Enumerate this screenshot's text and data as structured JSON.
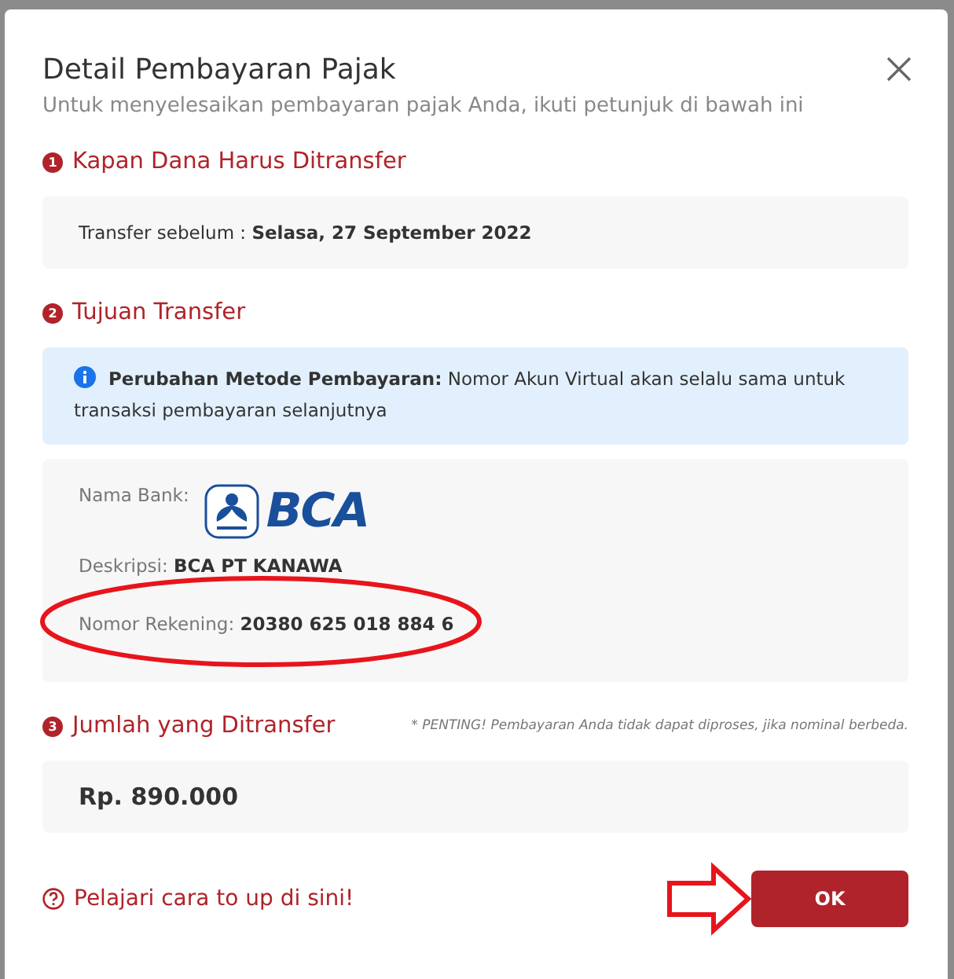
{
  "dialog": {
    "title": "Detail Pembayaran Pajak",
    "subtitle": "Untuk menyelesaikan pembayaran pajak Anda, ikuti petunjuk di bawah ini"
  },
  "sections": [
    {
      "number": "1",
      "heading": "Kapan Dana Harus Ditransfer",
      "kind": "deadline",
      "label": "Transfer sebelum :",
      "value": "Selasa, 27 September 2022"
    },
    {
      "number": "2",
      "heading": "Tujuan Transfer",
      "kind": "destination",
      "notice": "**Perubahan Metode Pembayaran:** Nomor Akun Virtual akan selalu sama untuk transaksi pembayaran selanjutnya",
      "bank_label": "Nama Bank:",
      "bank_logo_text": "BCA",
      "description_label": "Deskripsi:",
      "description_value": "BCA PT KANAWA",
      "account_label": "Nomor Rekening:",
      "account_value": "20380 625 018 884 6"
    },
    {
      "number": "3",
      "heading": "Jumlah yang Ditransfer",
      "kind": "amount",
      "note": "* PENTING! Pembayaran Anda tidak dapat diproses, jika nominal berbeda.",
      "value": "Rp. 890.000"
    }
  ],
  "help_link": "Pelajari cara to up di sini!",
  "ok_button": "OK"
}
